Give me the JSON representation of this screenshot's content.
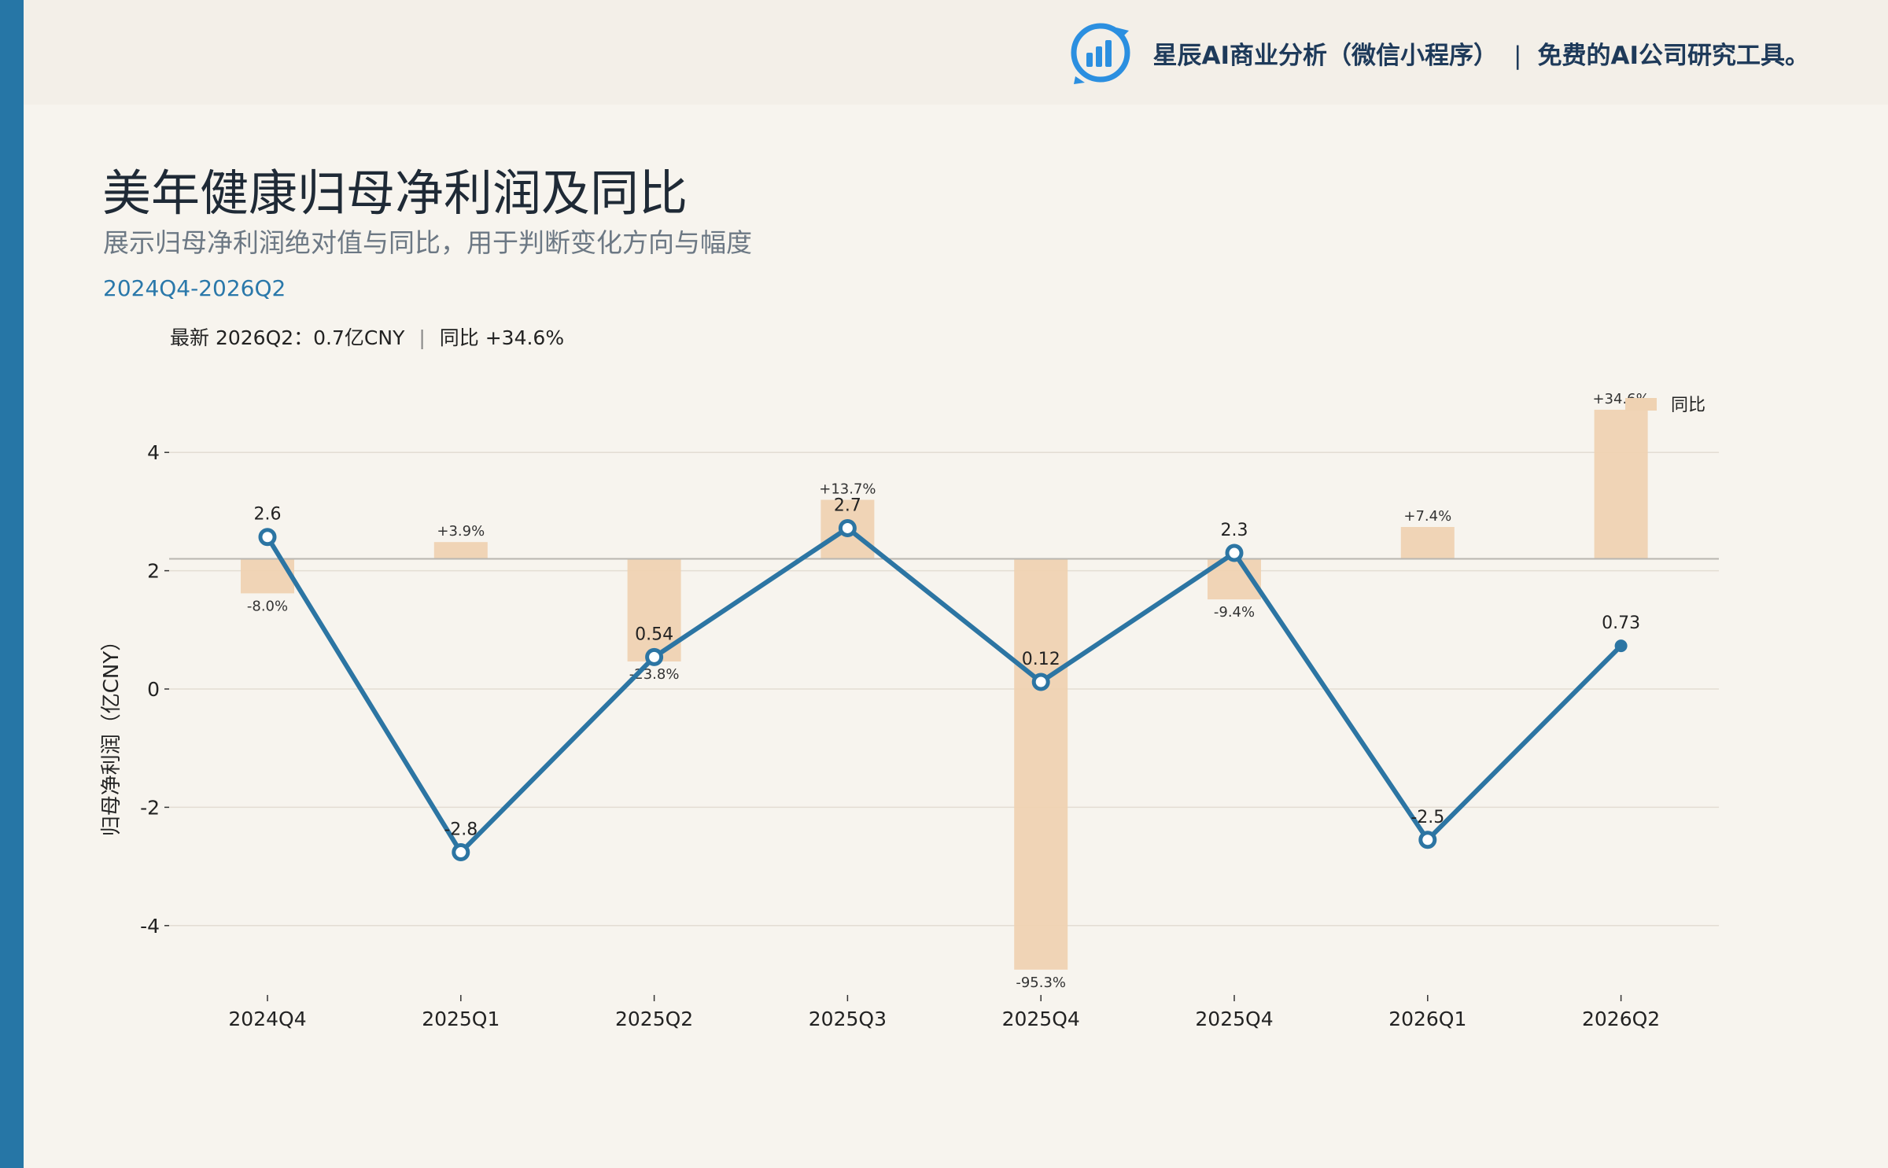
{
  "header": {
    "brand_name": "星辰AI商业分析（微信小程序）",
    "separator": "|",
    "tagline": "免费的AI公司研究工具。",
    "logo_icon": "bar-chart-circle-icon"
  },
  "page": {
    "title": "美年健康归母净利润及同比",
    "subtitle": "展示归母净利润绝对值与同比，用于判断变化方向与幅度",
    "range": "2024Q4-2026Q2",
    "latest_label": "最新 2026Q2：0.7亿CNY",
    "latest_separator": "|",
    "latest_yoy": "同比 +34.6%"
  },
  "colors": {
    "accent": "#2676a6",
    "line": "#2c75a3",
    "bar": "#efd2b2",
    "background": "#f7f4ee",
    "header_background": "#f3efe8"
  },
  "chart_data": {
    "type": "line",
    "title": "",
    "ylabel": "归母净利润（亿CNY）",
    "xlabel": "",
    "categories": [
      "2024Q4",
      "2025Q1",
      "2025Q2",
      "2025Q3",
      "2025Q4",
      "2025Q4",
      "2026Q1",
      "2026Q2"
    ],
    "ylim": [
      -5.2,
      5.0
    ],
    "yticks": [
      -4,
      -2,
      0,
      2,
      4
    ],
    "grid": true,
    "series": [
      {
        "name": "",
        "type": "line",
        "values": [
          2.57,
          -2.76,
          0.54,
          2.72,
          0.12,
          2.3,
          -2.55,
          0.73
        ],
        "labels": [
          "2.6",
          "-2.8",
          "0.54",
          "2.7",
          "0.12",
          "2.3",
          "-2.5",
          "0.73"
        ]
      },
      {
        "name": "同比",
        "type": "bar",
        "baseline": 2.2,
        "values": [
          -8.0,
          3.9,
          -23.8,
          13.7,
          -95.3,
          -9.4,
          7.4,
          34.6
        ],
        "labels": [
          "-8.0%",
          "+3.9%",
          "-23.8%",
          "+13.7%",
          "-95.3%",
          "-9.4%",
          "+7.4%",
          "+34.6%"
        ]
      }
    ],
    "legend": "top-right"
  }
}
